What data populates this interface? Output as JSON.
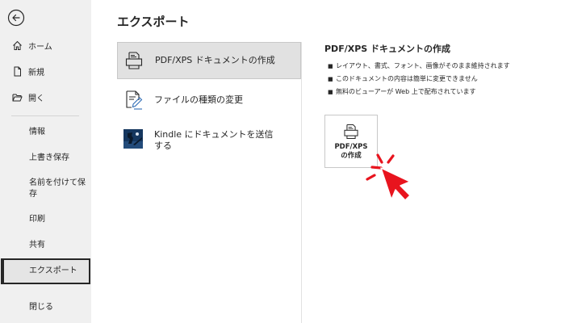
{
  "sidebar": {
    "back_label": "",
    "top_items": [
      {
        "label": "ホーム",
        "icon": "home-icon"
      },
      {
        "label": "新規",
        "icon": "new-document-icon"
      },
      {
        "label": "開く",
        "icon": "open-folder-icon"
      }
    ],
    "items": [
      {
        "label": "情報"
      },
      {
        "label": "上書き保存"
      },
      {
        "label": "名前を付けて保存"
      },
      {
        "label": "印刷"
      },
      {
        "label": "共有"
      },
      {
        "label": "エクスポート",
        "active": true
      },
      {
        "label": "閉じる"
      }
    ]
  },
  "main": {
    "title": "エクスポート",
    "options": [
      {
        "label": "PDF/XPS ドキュメントの作成",
        "icon": "pdf-document-icon",
        "selected": true
      },
      {
        "label": "ファイルの種類の変更",
        "icon": "change-file-type-icon"
      },
      {
        "label": "Kindle にドキュメントを送信する",
        "icon": "kindle-icon"
      }
    ],
    "detail": {
      "heading": "PDF/XPS ドキュメントの作成",
      "bullets": [
        "レイアウト、書式、フォント、画像がそのまま維持されます",
        "このドキュメントの内容は簡単に変更できません",
        "無料のビューアーが Web 上で配布されています"
      ],
      "button": {
        "line1": "PDF/XPS",
        "line2": "の作成"
      }
    }
  },
  "colors": {
    "sidebar_bg": "#f0f0f0",
    "selected_bg": "#e1e1e1",
    "annotation_red": "#e8141e"
  }
}
